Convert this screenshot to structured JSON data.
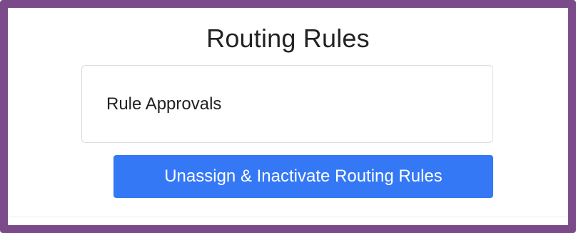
{
  "header": {
    "title": "Routing Rules"
  },
  "card": {
    "label": "Rule Approvals"
  },
  "actions": {
    "primary_label": "Unassign & Inactivate Routing Rules"
  },
  "colors": {
    "frame": "#7b4a8a",
    "primary": "#3478f6",
    "text": "#222222",
    "card_border": "#dcdcdc"
  }
}
